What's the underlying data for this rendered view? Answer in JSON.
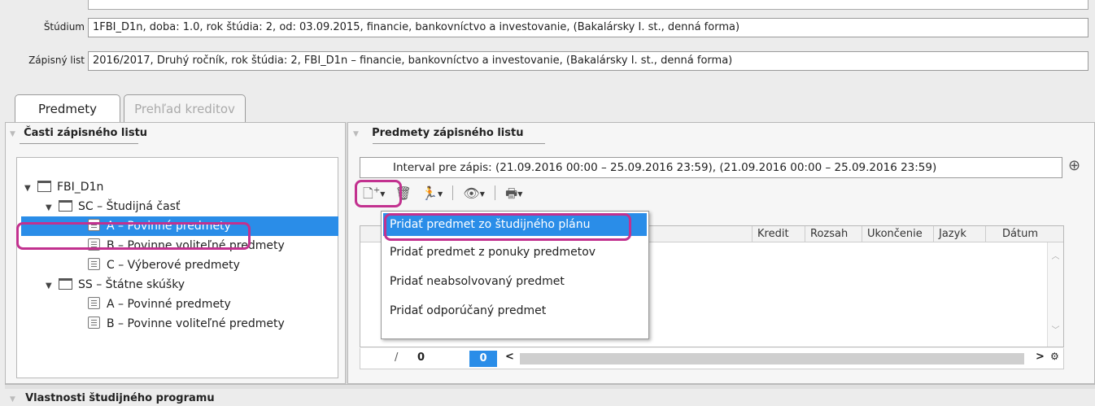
{
  "info": {
    "studium_label": "Štúdium",
    "studium_value": "1FBI_D1n, doba: 1.0, rok štúdia: 2, od: 03.09.2015, financie, bankovníctvo a investovanie, (Bakalársky I. st., denná forma)",
    "zapisny_label": "Zápisný list",
    "zapisny_value": "2016/2017, Druhý ročník, rok štúdia: 2, FBI_D1n – financie, bankovníctvo a investovanie, (Bakalársky I. st., denná forma)"
  },
  "tabs": [
    {
      "label": "Predmety",
      "active": true
    },
    {
      "label": "Prehľad kreditov",
      "active": false
    }
  ],
  "left_panel": {
    "title": "Časti zápisného listu",
    "tree": [
      {
        "label": "FBI_D1n"
      },
      {
        "label": "SC – Študijná časť"
      },
      {
        "label": "A – Povinné predmety",
        "selected": true
      },
      {
        "label": "B – Povinne voliteľné predmety"
      },
      {
        "label": "C – Výberové predmety"
      },
      {
        "label": "SS – Štátne skúšky"
      },
      {
        "label": "A – Povinné predmety"
      },
      {
        "label": "B – Povinne voliteľné predmety"
      }
    ]
  },
  "right_panel": {
    "title": "Predmety zápisného listu",
    "interval": "Interval pre zápis: (21.09.2016 00:00 – 25.09.2016 23:59), (21.09.2016 00:00 – 25.09.2016 23:59)",
    "columns": [
      "Kredit",
      "Rozsah",
      "Ukončenie",
      "Jazyk",
      "Dátum"
    ],
    "pager": {
      "separator": "/",
      "total": "0",
      "current": "0"
    }
  },
  "dropdown_menu": [
    "Pridať predmet zo študijného plánu",
    "Pridať predmet z ponuky predmetov",
    "Pridať neabsolvovaný predmet",
    "Pridať odporúčaný predmet"
  ],
  "bottom_panel": {
    "title": "Vlastnosti študijného programu"
  },
  "colors": {
    "selection": "#2a8de8",
    "highlight": "#c2318f"
  }
}
